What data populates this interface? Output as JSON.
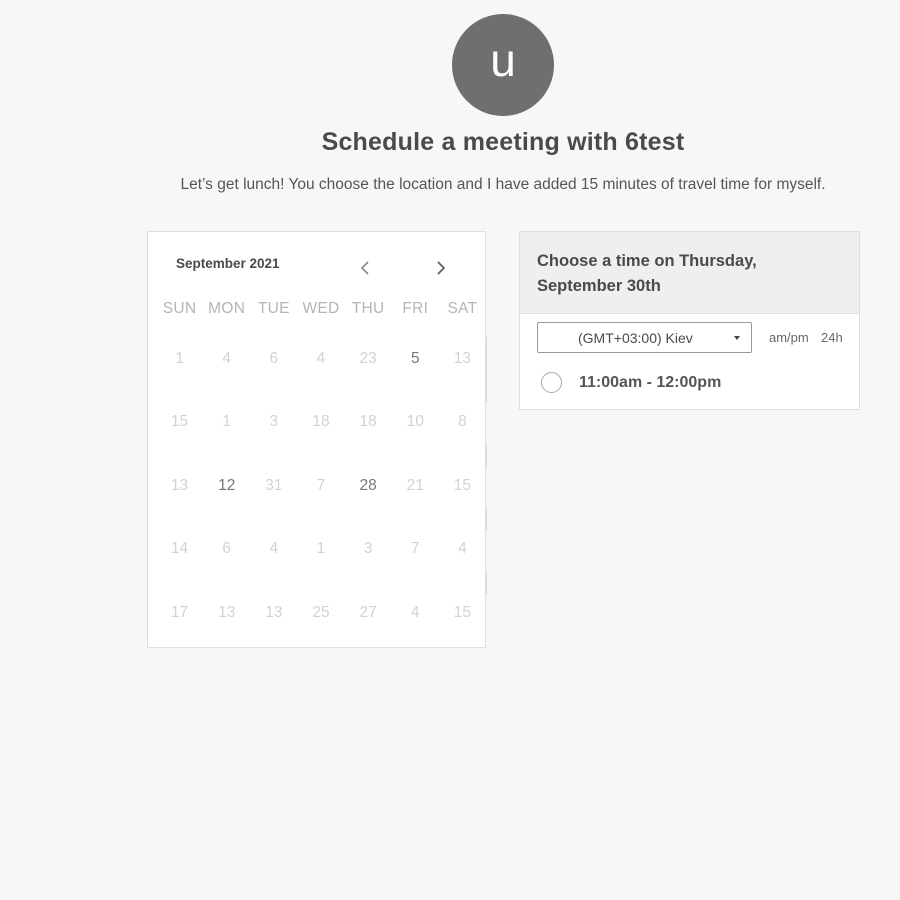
{
  "host": {
    "avatar_initial": "u"
  },
  "header": {
    "title": "Schedule a meeting with 6test",
    "description": "Let’s get lunch! You choose the location and I have added 15 minutes of travel time for myself."
  },
  "calendar": {
    "month_label": "September 2021",
    "prev_icon": "chevron-left-icon",
    "next_icon": "chevron-right-icon",
    "weekdays": [
      "SUN",
      "MON",
      "TUE",
      "WED",
      "THU",
      "FRI",
      "SAT"
    ],
    "weeks": [
      [
        {
          "day": "1",
          "available": false
        },
        {
          "day": "4",
          "available": false
        },
        {
          "day": "6",
          "available": false
        },
        {
          "day": "4",
          "available": false
        },
        {
          "day": "23",
          "available": false
        },
        {
          "day": "5",
          "available": true
        },
        {
          "day": "13",
          "available": false
        }
      ],
      [
        {
          "day": "15",
          "available": false
        },
        {
          "day": "1",
          "available": false
        },
        {
          "day": "3",
          "available": false
        },
        {
          "day": "18",
          "available": false
        },
        {
          "day": "18",
          "available": false
        },
        {
          "day": "10",
          "available": false
        },
        {
          "day": "8",
          "available": false
        }
      ],
      [
        {
          "day": "13",
          "available": false
        },
        {
          "day": "12",
          "available": true
        },
        {
          "day": "31",
          "available": false
        },
        {
          "day": "7",
          "available": false
        },
        {
          "day": "28",
          "available": true
        },
        {
          "day": "21",
          "available": false
        },
        {
          "day": "15",
          "available": false
        }
      ],
      [
        {
          "day": "14",
          "available": false
        },
        {
          "day": "6",
          "available": false
        },
        {
          "day": "4",
          "available": false
        },
        {
          "day": "1",
          "available": false
        },
        {
          "day": "3",
          "available": false
        },
        {
          "day": "7",
          "available": false
        },
        {
          "day": "4",
          "available": false
        }
      ],
      [
        {
          "day": "17",
          "available": false
        },
        {
          "day": "13",
          "available": false
        },
        {
          "day": "13",
          "available": false
        },
        {
          "day": "25",
          "available": false
        },
        {
          "day": "27",
          "available": false
        },
        {
          "day": "4",
          "available": false
        },
        {
          "day": "15",
          "available": false
        }
      ]
    ]
  },
  "time_panel": {
    "heading": "Choose a time on Thursday, September 30th",
    "timezone": {
      "selected": "(GMT+03:00) Kiev",
      "icon": "caret-down-icon"
    },
    "format_options": [
      "am/pm",
      "24h"
    ],
    "slots": [
      {
        "label": "11:00am - 12:00pm",
        "selected": false
      }
    ]
  }
}
